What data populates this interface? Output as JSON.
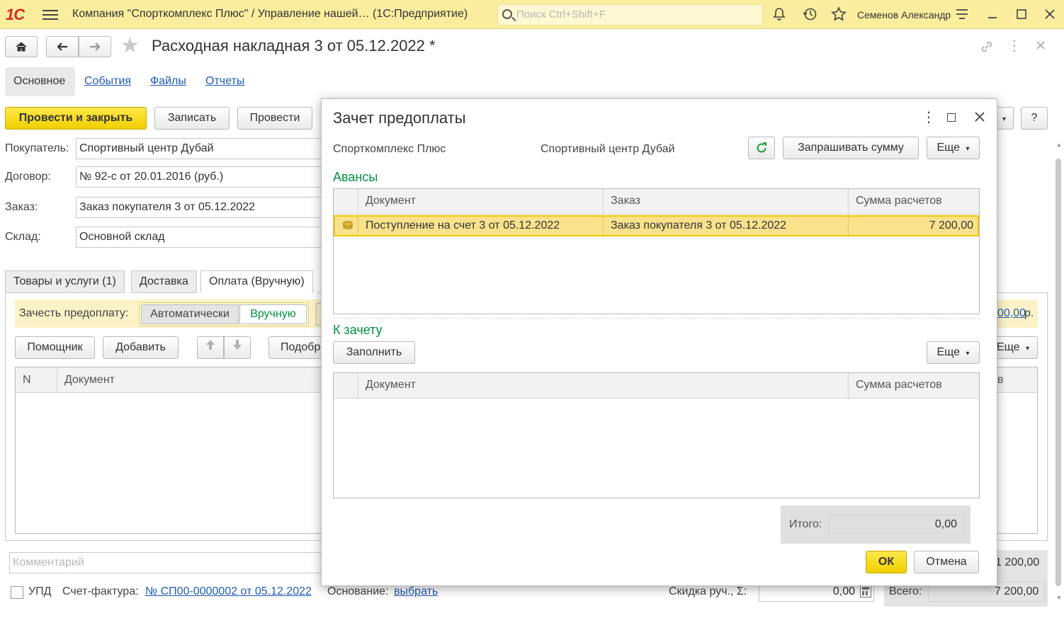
{
  "app": {
    "title": "Компания \"Спорткомплекс Плюс\" / Управление нашей…  (1С:Предприятие)",
    "search_placeholder": "Поиск Ctrl+Shift+F",
    "user": "Семенов Александр"
  },
  "document": {
    "title": "Расходная накладная 3 от 05.12.2022 *",
    "tabs": [
      "Основное",
      "События",
      "Файлы",
      "Отчеты"
    ]
  },
  "toolbar": {
    "post_close": "Провести и закрыть",
    "save": "Записать",
    "post": "Провести",
    "help": "?"
  },
  "form": {
    "buyer_label": "Покупатель:",
    "buyer_value": "Спортивный центр Дубай",
    "contract_label": "Договор:",
    "contract_value": "№ 92-с от 20.01.2016 (руб.)",
    "order_label": "Заказ:",
    "order_value": "Заказ покупателя 3 от 05.12.2022",
    "warehouse_label": "Склад:",
    "warehouse_value": "Основной склад"
  },
  "bottom_tabs": [
    "Товары и услуги (1)",
    "Доставка",
    "Оплата (Вручную)"
  ],
  "payment": {
    "prepay_label": "Зачесть предоплату:",
    "auto": "Автоматически",
    "manual": "Вручную",
    "amount_fragment": "00,00",
    "currency_fragment": "р."
  },
  "grid_buttons": {
    "helper": "Помощник",
    "add": "Добавить",
    "pick": "Подобр",
    "more": "Еще"
  },
  "main_grid": {
    "col_n": "N",
    "col_doc": "Документ",
    "col_right_fragment": "в"
  },
  "footer": {
    "comment_placeholder": "Комментарий",
    "upd": "УПД",
    "invoice_label": "Счет-фактура:",
    "invoice_link": "№ СП00-0000002 от 05.12.2022",
    "basis_label": "Основание:",
    "basis_link": "выбрать",
    "discount_label": "Скидка руч., Σ:",
    "discount_value": "0,00",
    "total_label": "Всего:",
    "total_value": "7 200,00",
    "subtotal_fragment": "1 200,00"
  },
  "modal": {
    "title": "Зачет предоплаты",
    "org": "Спорткомплекс Плюс",
    "counterparty": "Спортивный центр Дубай",
    "ask_sum": "Запрашивать сумму",
    "more": "Еще",
    "advances_title": "Авансы",
    "advances_cols": [
      "Документ",
      "Заказ",
      "Сумма расчетов"
    ],
    "advances_rows": [
      {
        "doc": "Поступление на счет 3 от 05.12.2022",
        "order": "Заказ покупателя 3 от 05.12.2022",
        "sum": "7 200,00"
      }
    ],
    "offset_title": "К зачету",
    "fill": "Заполнить",
    "offset_cols": [
      "Документ",
      "Сумма расчетов"
    ],
    "total_label": "Итого:",
    "total_value": "0,00",
    "ok": "ОК",
    "cancel": "Отмена"
  }
}
